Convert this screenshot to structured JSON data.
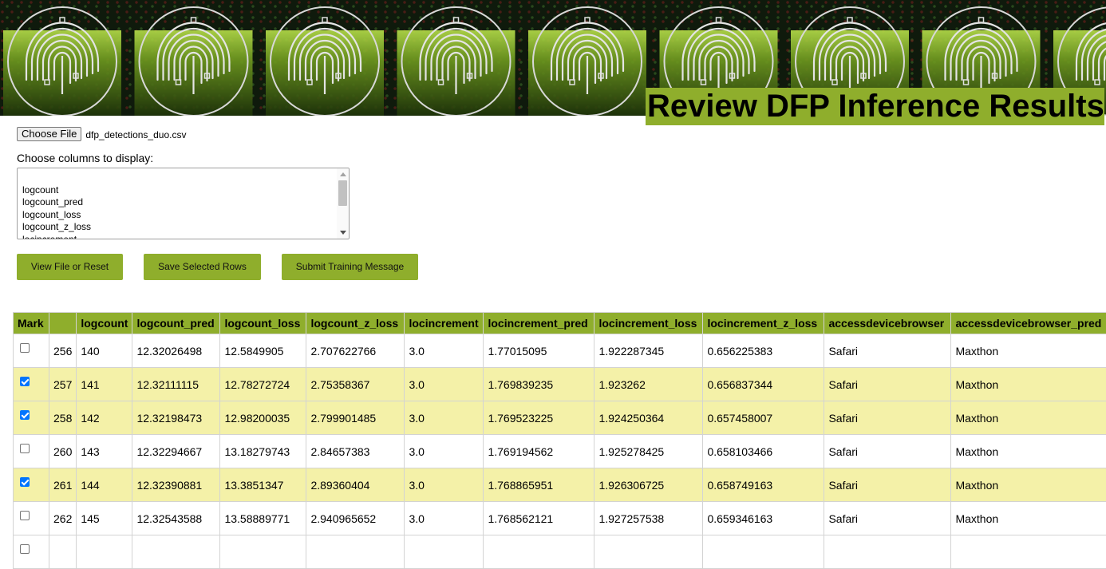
{
  "header": {
    "title": "Review DFP Inference Results"
  },
  "file": {
    "choose_label": "Choose File",
    "file_name": "dfp_detections_duo.csv"
  },
  "columns": {
    "label": "Choose columns to display:",
    "options": [
      "logcount",
      "logcount_pred",
      "logcount_loss",
      "logcount_z_loss",
      "locincrement"
    ]
  },
  "buttons": {
    "view": "View File or Reset",
    "save": "Save Selected Rows",
    "submit": "Submit Training Message"
  },
  "colors": {
    "accent": "#8fae2c",
    "selected_row": "#f4f1a8",
    "banner": "#0f1a0c"
  },
  "icons": [
    "fingerprint-icon"
  ],
  "table": {
    "headers": [
      "Mark",
      "",
      "logcount",
      "logcount_pred",
      "logcount_loss",
      "logcount_z_loss",
      "locincrement",
      "locincrement_pred",
      "locincrement_loss",
      "locincrement_z_loss",
      "accessdevicebrowser",
      "accessdevicebrowser_pred"
    ],
    "rows": [
      {
        "checked": false,
        "cells": [
          "256",
          "140",
          "12.32026498",
          "12.5849905",
          "2.707622766",
          "3.0",
          "1.77015095",
          "1.922287345",
          "0.656225383",
          "Safari",
          "Maxthon"
        ]
      },
      {
        "checked": true,
        "cells": [
          "257",
          "141",
          "12.32111115",
          "12.78272724",
          "2.75358367",
          "3.0",
          "1.769839235",
          "1.923262",
          "0.656837344",
          "Safari",
          "Maxthon"
        ]
      },
      {
        "checked": true,
        "cells": [
          "258",
          "142",
          "12.32198473",
          "12.98200035",
          "2.799901485",
          "3.0",
          "1.769523225",
          "1.924250364",
          "0.657458007",
          "Safari",
          "Maxthon"
        ]
      },
      {
        "checked": false,
        "cells": [
          "260",
          "143",
          "12.32294667",
          "13.18279743",
          "2.84657383",
          "3.0",
          "1.769194562",
          "1.925278425",
          "0.658103466",
          "Safari",
          "Maxthon"
        ]
      },
      {
        "checked": true,
        "cells": [
          "261",
          "144",
          "12.32390881",
          "13.3851347",
          "2.89360404",
          "3.0",
          "1.768865951",
          "1.926306725",
          "0.658749163",
          "Safari",
          "Maxthon"
        ]
      },
      {
        "checked": false,
        "cells": [
          "262",
          "145",
          "12.32543588",
          "13.58889771",
          "2.940965652",
          "3.0",
          "1.768562121",
          "1.927257538",
          "0.659346163",
          "Safari",
          "Maxthon"
        ]
      },
      {
        "checked": false,
        "cells": [
          "",
          "",
          "",
          "",
          "",
          "",
          "",
          "",
          "",
          "",
          ""
        ]
      }
    ]
  }
}
